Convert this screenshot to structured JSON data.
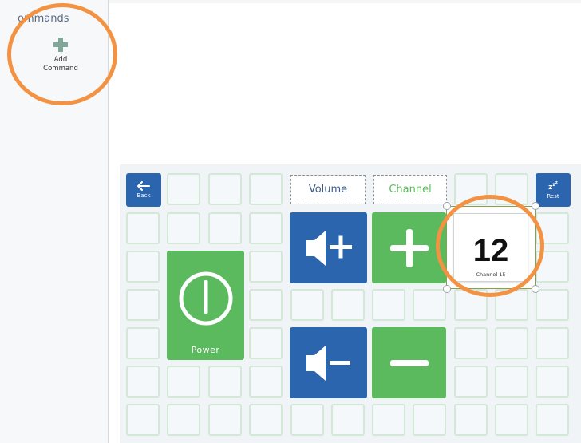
{
  "sidebar": {
    "title": "ommands",
    "add_command": {
      "line1": "Add",
      "line2": "Command",
      "icon": "plus-icon"
    }
  },
  "board": {
    "back": {
      "label": "Back",
      "icon": "arrow-left-icon"
    },
    "rest": {
      "label": "Rest",
      "icon": "sleep-zzz-icon"
    },
    "volume_label": "Volume",
    "channel_label": "Channel",
    "volume_up": {
      "icon": "speaker-plus-icon"
    },
    "volume_down": {
      "icon": "speaker-minus-icon"
    },
    "channel_up": {
      "icon": "plus-icon"
    },
    "channel_down": {
      "icon": "minus-icon"
    },
    "power": {
      "label": "Power",
      "icon": "power-icon"
    },
    "channel_tile": {
      "number": "12",
      "caption": "Channel 15"
    }
  },
  "colors": {
    "blue_button": "#2b65ae",
    "green_button": "#5cba5e",
    "cell_border": "#d3e8d7",
    "highlight": "#f39242",
    "volume_text": "#3e5b86",
    "channel_text": "#5cba5e"
  }
}
